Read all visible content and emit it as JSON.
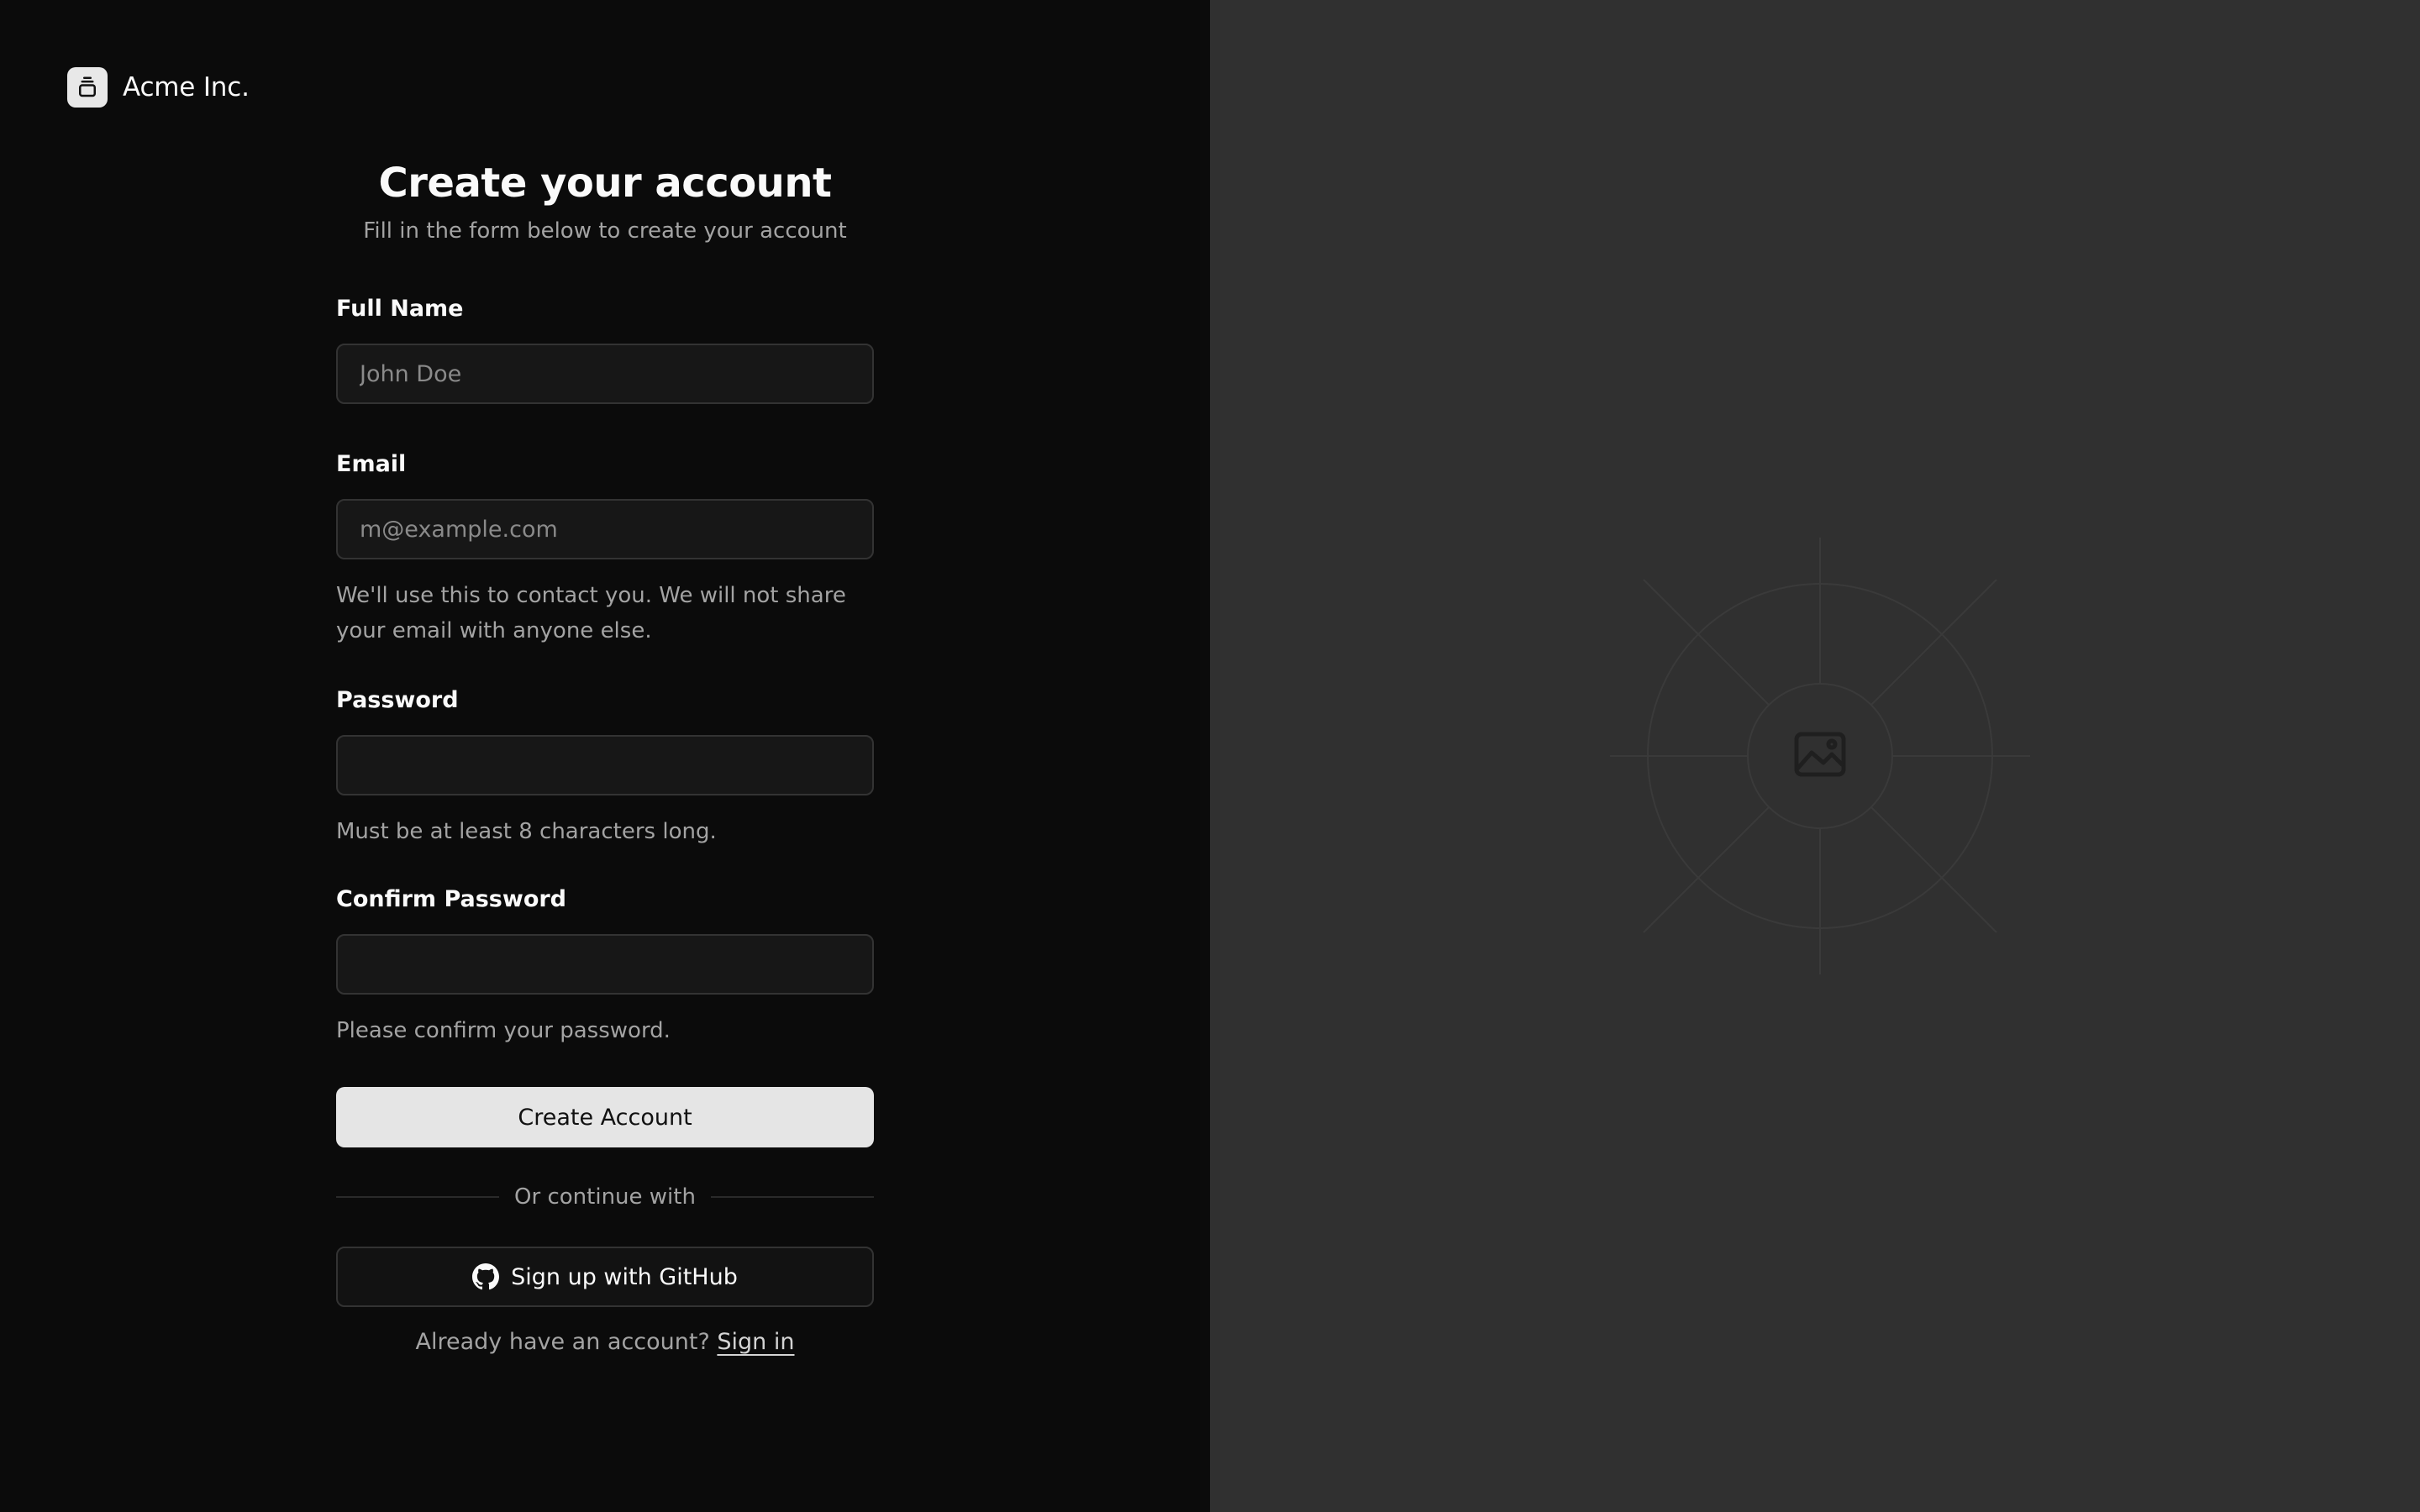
{
  "brand": {
    "name": "Acme Inc.",
    "logo_icon": "stacked-box-icon"
  },
  "form": {
    "title": "Create your account",
    "subtitle": "Fill in the form below to create your account",
    "full_name": {
      "label": "Full Name",
      "placeholder": "John Doe",
      "value": ""
    },
    "email": {
      "label": "Email",
      "placeholder": "m@example.com",
      "value": "",
      "hint": "We'll use this to contact you. We will not share your email with anyone else."
    },
    "password": {
      "label": "Password",
      "placeholder": "",
      "value": "",
      "hint": "Must be at least 8 characters long."
    },
    "confirm_password": {
      "label": "Confirm Password",
      "placeholder": "",
      "value": "",
      "hint": "Please confirm your password."
    },
    "submit_label": "Create Account",
    "divider_text": "Or continue with",
    "github_label": "Sign up with GitHub",
    "github_icon": "github-icon",
    "signin_prompt": "Already have an account?",
    "signin_link": "Sign in"
  },
  "illustration": {
    "icon": "image-placeholder-icon"
  },
  "colors": {
    "left_background": "#0b0b0b",
    "right_background": "#303030",
    "primary_button": "#e5e5e5",
    "muted_text": "#a3a3a3"
  }
}
